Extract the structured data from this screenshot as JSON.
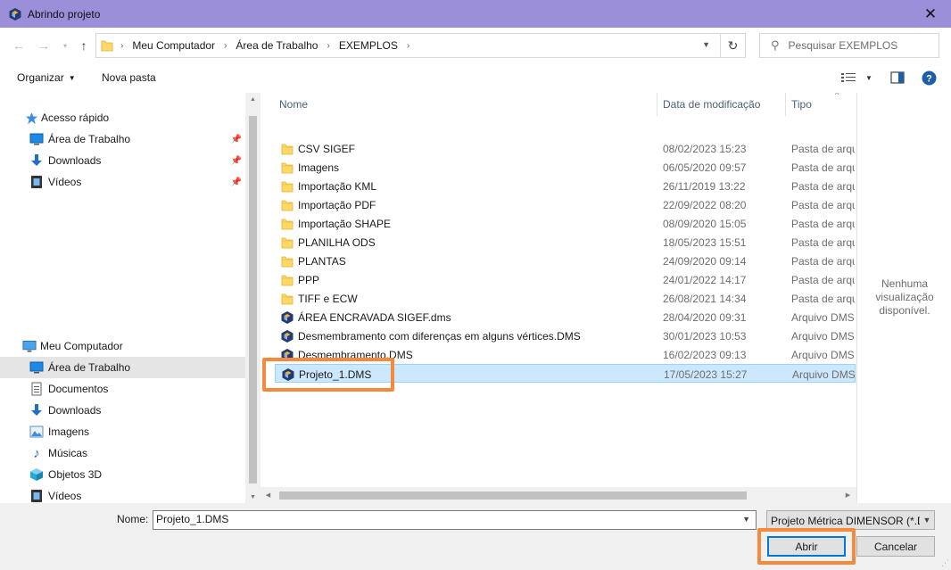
{
  "window": {
    "title": "Abrindo projeto"
  },
  "nav": {
    "breadcrumb": [
      "Meu Computador",
      "Área de Trabalho",
      "EXEMPLOS"
    ],
    "search_placeholder": "Pesquisar EXEMPLOS"
  },
  "toolbar": {
    "organize_label": "Organizar",
    "new_folder_label": "Nova pasta"
  },
  "sidebar": {
    "quick_access": {
      "label": "Acesso rápido",
      "items": [
        {
          "label": "Área de Trabalho",
          "icon": "desktop-icon"
        },
        {
          "label": "Downloads",
          "icon": "downloads-icon"
        },
        {
          "label": "Vídeos",
          "icon": "videos-icon"
        }
      ]
    },
    "computer": {
      "label": "Meu Computador",
      "items": [
        {
          "label": "Área de Trabalho",
          "icon": "desktop-icon"
        },
        {
          "label": "Documentos",
          "icon": "documents-icon"
        },
        {
          "label": "Downloads",
          "icon": "downloads-icon"
        },
        {
          "label": "Imagens",
          "icon": "pictures-icon"
        },
        {
          "label": "Músicas",
          "icon": "music-icon"
        },
        {
          "label": "Objetos 3D",
          "icon": "3d-objects-icon"
        },
        {
          "label": "Vídeos",
          "icon": "videos-icon"
        }
      ]
    }
  },
  "columns": {
    "name": "Nome",
    "date": "Data de modificação",
    "type": "Tipo"
  },
  "files": [
    {
      "name": "CSV SIGEF",
      "date": "08/02/2023 15:23",
      "type": "Pasta de arquivos",
      "icon": "folder-icon"
    },
    {
      "name": "Imagens",
      "date": "06/05/2020 09:57",
      "type": "Pasta de arquivos",
      "icon": "folder-icon"
    },
    {
      "name": "Importação KML",
      "date": "26/11/2019 13:22",
      "type": "Pasta de arquivos",
      "icon": "folder-icon"
    },
    {
      "name": "Importação PDF",
      "date": "22/09/2022 08:20",
      "type": "Pasta de arquivos",
      "icon": "folder-icon"
    },
    {
      "name": "Importação SHAPE",
      "date": "08/09/2020 15:05",
      "type": "Pasta de arquivos",
      "icon": "folder-icon"
    },
    {
      "name": "PLANILHA ODS",
      "date": "18/05/2023 15:51",
      "type": "Pasta de arquivos",
      "icon": "folder-icon"
    },
    {
      "name": "PLANTAS",
      "date": "24/09/2020 09:14",
      "type": "Pasta de arquivos",
      "icon": "folder-icon"
    },
    {
      "name": "PPP",
      "date": "24/01/2022 14:17",
      "type": "Pasta de arquivos",
      "icon": "folder-icon"
    },
    {
      "name": "TIFF e ECW",
      "date": "26/08/2021 14:34",
      "type": "Pasta de arquivos",
      "icon": "folder-icon"
    },
    {
      "name": "ÁREA ENCRAVADA SIGEF.dms",
      "date": "28/04/2020 09:31",
      "type": "Arquivo DMS",
      "icon": "dms-file-icon"
    },
    {
      "name": "Desmembramento com diferenças em alguns vértices.DMS",
      "date": "30/01/2023 10:53",
      "type": "Arquivo DMS",
      "icon": "dms-file-icon"
    },
    {
      "name": "Desmembramento.DMS",
      "date": "16/02/2023 09:13",
      "type": "Arquivo DMS",
      "icon": "dms-file-icon"
    },
    {
      "name": "Projeto_1.DMS",
      "date": "17/05/2023 15:27",
      "type": "Arquivo DMS",
      "icon": "dms-file-icon",
      "selected": true
    }
  ],
  "preview": {
    "message": "Nenhuma visualização disponível."
  },
  "footer": {
    "name_label": "Nome:",
    "filename": "Projeto_1.DMS",
    "filetype": "Projeto Métrica DIMENSOR (*.DMS)",
    "open_label": "Abrir",
    "cancel_label": "Cancelar"
  },
  "colors": {
    "highlight": "#f58a3c",
    "titlebar": "#9a8fd8",
    "selection": "#cce8ff"
  }
}
